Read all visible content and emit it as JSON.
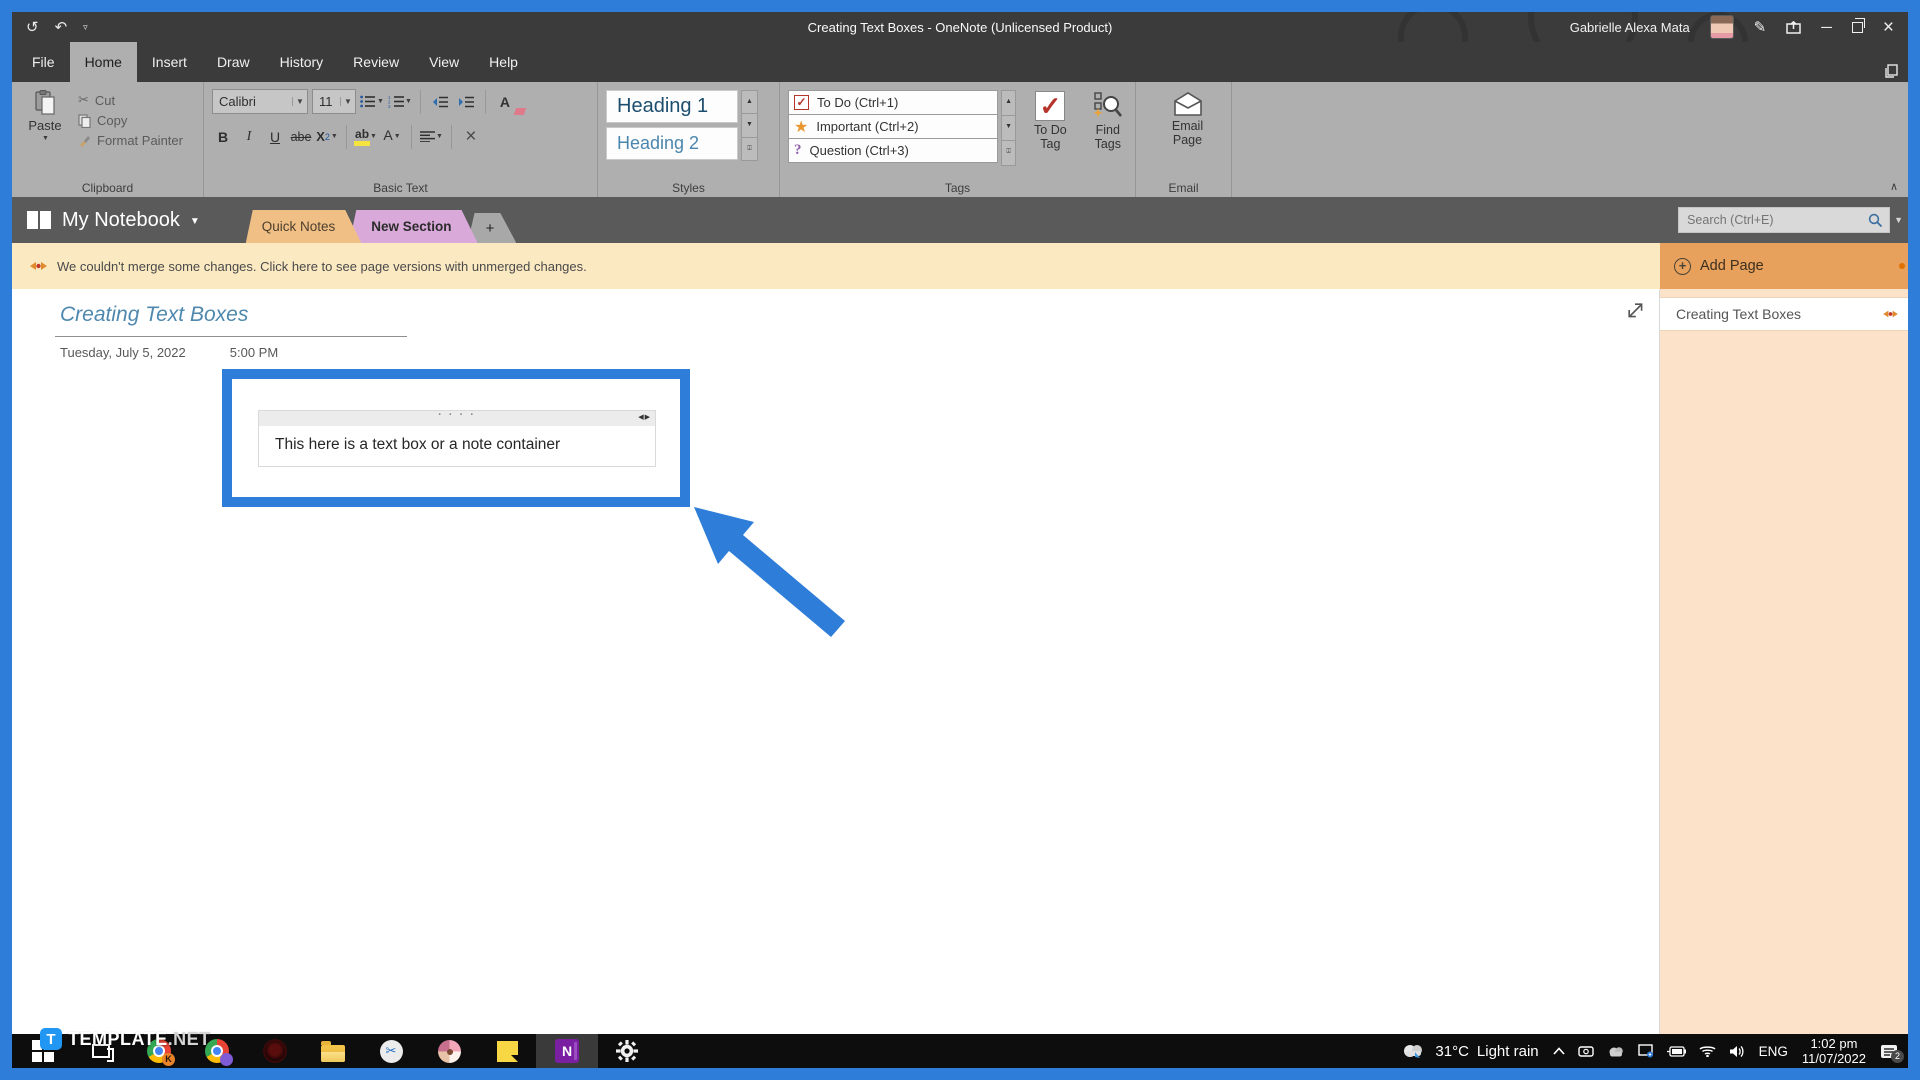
{
  "window": {
    "title": "Creating Text Boxes - OneNote (Unlicensed Product)",
    "user": "Gabrielle Alexa Mata"
  },
  "menu": {
    "items": [
      "File",
      "Home",
      "Insert",
      "Draw",
      "History",
      "Review",
      "View",
      "Help"
    ]
  },
  "ribbon": {
    "clipboard": {
      "label": "Clipboard",
      "paste": "Paste",
      "cut": "Cut",
      "copy": "Copy",
      "format_painter": "Format Painter"
    },
    "basic_text": {
      "label": "Basic Text",
      "font": "Calibri",
      "size": "11",
      "bold": "B",
      "italic": "I",
      "underline": "U",
      "strikethrough": "abe",
      "subscript": "X",
      "subscript_sub": "2",
      "highlight": "ab",
      "font_color": "A",
      "clear_format": "A"
    },
    "styles": {
      "label": "Styles",
      "heading1": "Heading 1",
      "heading2": "Heading 2"
    },
    "tags": {
      "label": "Tags",
      "todo": "To Do (Ctrl+1)",
      "important": "Important (Ctrl+2)",
      "question": "Question (Ctrl+3)",
      "todo_check": "✓",
      "todo_tag_line1": "To Do",
      "todo_tag_line2": "Tag",
      "find_tags_line1": "Find",
      "find_tags_line2": "Tags"
    },
    "email": {
      "label": "Email",
      "line1": "Email",
      "line2": "Page"
    }
  },
  "notebook_bar": {
    "notebook": "My Notebook",
    "tab_quick_notes": "Quick Notes",
    "tab_new_section": "New Section",
    "tab_add": "+",
    "search_placeholder": "Search (Ctrl+E)"
  },
  "warning": {
    "text": "We couldn't merge some changes. Click here to see page versions with unmerged changes."
  },
  "page": {
    "title": "Creating Text Boxes",
    "date": "Tuesday, July 5, 2022",
    "time": "5:00 PM",
    "note_text": "This here is a text box or a note container",
    "note_grip": "· · · ·",
    "note_resize": "◀▶"
  },
  "panel": {
    "add_page": "Add Page",
    "page_title": "Creating Text Boxes"
  },
  "taskbar": {
    "onenote_letter": "N",
    "browser_badge": "K",
    "weather_temp": "31°C",
    "weather_desc": "Light rain",
    "lang": "ENG",
    "time": "1:02 pm",
    "date": "11/07/2022",
    "notification_badge": "2"
  },
  "watermark": {
    "brand": "TEMPLATE",
    "tld": ".NET"
  },
  "colors": {
    "accent_blue": "#2e7dd9",
    "tag_red": "#b5342c",
    "tag_orange": "#e8962e",
    "tag_purple": "#8e5fa8",
    "panel_peach": "#fbe2c9",
    "warning_cream": "#fbe9c2"
  }
}
